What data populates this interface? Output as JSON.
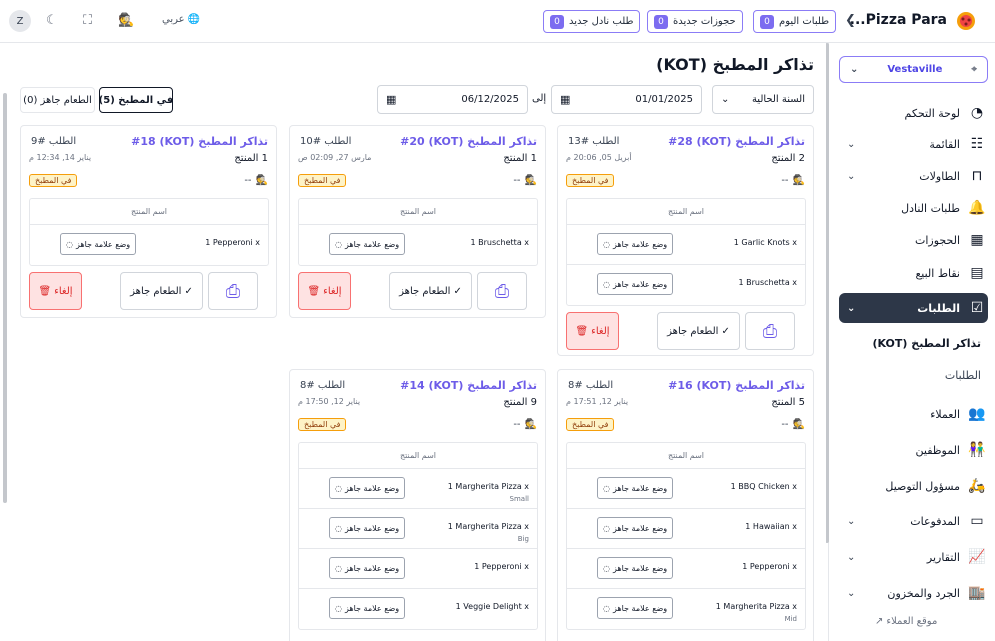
{
  "topbar": {
    "brand": "Pizza Para...",
    "pills": [
      {
        "label": "طلبات اليوم",
        "count": "0"
      },
      {
        "label": "حجوزات جديدة",
        "count": "0"
      },
      {
        "label": "طلب نادل جديد",
        "count": "0"
      }
    ],
    "language": "عربي",
    "avatar": "Z"
  },
  "sidebar": {
    "location": "Vestaville",
    "items": [
      {
        "label": "لوحة التحكم",
        "icon": "dashboard-icon",
        "chev": false
      },
      {
        "label": "القائمة",
        "icon": "menu-icon",
        "chev": true
      },
      {
        "label": "الطاولات",
        "icon": "table-icon",
        "chev": true
      },
      {
        "label": "طلبات النادل",
        "icon": "bell-icon",
        "chev": false
      },
      {
        "label": "الحجوزات",
        "icon": "calendar-icon",
        "chev": false
      },
      {
        "label": "نقاط البيع",
        "icon": "pos-icon",
        "chev": false
      },
      {
        "label": "الطلبات",
        "icon": "orders-icon",
        "chev": true,
        "active": true
      },
      {
        "label": "العملاء",
        "icon": "customers-icon",
        "chev": false
      },
      {
        "label": "الموظفين",
        "icon": "staff-icon",
        "chev": false
      },
      {
        "label": "مسؤول التوصيل",
        "icon": "delivery-icon",
        "chev": false
      },
      {
        "label": "المدفوعات",
        "icon": "payments-icon",
        "chev": true
      },
      {
        "label": "التقارير",
        "icon": "reports-icon",
        "chev": true
      },
      {
        "label": "الجرد والمخزون",
        "icon": "inventory-icon",
        "chev": true
      }
    ],
    "sub_kot": "تذاكر المطبخ (KOT)",
    "sub_orders": "الطلبات",
    "customer_site": "موقع العملاء"
  },
  "main": {
    "title": "تذاكر المطبخ (KOT)",
    "period": "السنة الحالية",
    "date_from": "01/01/2025",
    "to_label": "إلى",
    "date_to": "06/12/2025",
    "tab_kitchen": "في المطبخ (5)",
    "tab_ready": "الطعام جاهز (0)",
    "col_header": "اسم المنتج",
    "mark_label": "وضع علامة جاهز",
    "ready_label": "الطعام جاهز",
    "cancel_label": "إلغاء",
    "status_label": "في المطبخ",
    "waiter": "--"
  },
  "cards": [
    {
      "title": "تذاكر المطبخ (KOT) #28",
      "order": "الطلب #13",
      "count": "2 المنتج",
      "date": "أبريل 05, 20:06 م",
      "items": [
        {
          "name": "1 Garlic Knots x",
          "variant": ""
        },
        {
          "name": "1 Bruschetta x",
          "variant": ""
        }
      ]
    },
    {
      "title": "تذاكر المطبخ (KOT) #20",
      "order": "الطلب #10",
      "count": "1 المنتج",
      "date": "مارس 27, 02:09 ص",
      "items": [
        {
          "name": "1 Bruschetta x",
          "variant": ""
        }
      ]
    },
    {
      "title": "تذاكر المطبخ (KOT) #18",
      "order": "الطلب #9",
      "count": "1 المنتج",
      "date": "يناير 14, 12:34 م",
      "items": [
        {
          "name": "1 Pepperoni x",
          "variant": ""
        }
      ]
    },
    {
      "title": "تذاكر المطبخ (KOT) #16",
      "order": "الطلب #8",
      "count": "5 المنتج",
      "date": "يناير 12, 17:51 م",
      "items": [
        {
          "name": "1 BBQ Chicken x",
          "variant": ""
        },
        {
          "name": "1 Hawaiian x",
          "variant": ""
        },
        {
          "name": "1 Pepperoni x",
          "variant": ""
        },
        {
          "name": "1 Margherita Pizza x",
          "variant": "Mid"
        }
      ]
    },
    {
      "title": "تذاكر المطبخ (KOT) #14",
      "order": "الطلب #8",
      "count": "9 المنتج",
      "date": "يناير 12, 17:50 م",
      "items": [
        {
          "name": "1 Margherita Pizza x",
          "variant": "Small"
        },
        {
          "name": "1 Margherita Pizza x",
          "variant": "Big"
        },
        {
          "name": "1 Pepperoni x",
          "variant": ""
        },
        {
          "name": "1 Veggie Delight x",
          "variant": ""
        }
      ]
    }
  ]
}
